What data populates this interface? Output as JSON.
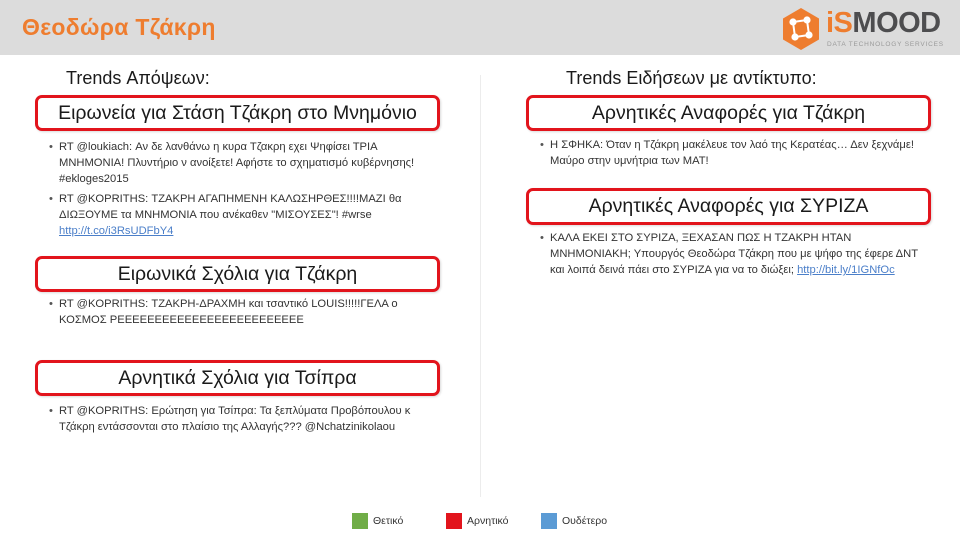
{
  "header": {
    "title": "Θεοδώρα Τζάκρη",
    "logo": {
      "text_i": "iS",
      "text_rest": "MOOD",
      "tagline": "DATA TECHNOLOGY SERVICES",
      "icon": "hexagon-network-icon",
      "accent_color": "#ee7d2f"
    }
  },
  "left": {
    "heading": "Trends Απόψεων:",
    "groups": [
      {
        "title": "Ειρωνεία για Στάση Τζάκρη στο Μνημόνιο",
        "items": [
          {
            "text": "RT @loukiach: Αν δε λανθάνω η κυρα Τζακρη εχει Ψηφίσει ΤΡΙΑ ΜΝΗΜΟΝΙΑ! Πλυντήριο ν ανοίξετε! Αφήστε το σχηματισμό κυβέρνησης! #ekloges2015",
            "link": ""
          },
          {
            "text": "RT @KOPRITHS: ΤΖΑΚΡΗ ΑΓΑΠΗΜΕΝΗ ΚΑΛΩΣΗΡΘΕΣ!!!!ΜΑΖΙ θα ΔΙΩΞΟΥΜΕ τα ΜΝΗΜΟΝΙΑ που ανέκαθεν \"ΜΙΣΟΥΣΕΣ\"! #wrse",
            "link": "http://t.co/i3RsUDFbY4"
          }
        ]
      },
      {
        "title": "Ειρωνικά Σχόλια για Τζάκρη",
        "items": [
          {
            "text": "RT @KOPRITHS: ΤΖΑΚΡΗ-ΔΡΑΧΜΗ και τσαντικό LOUIS!!!!!ΓΕΛΑ ο ΚΟΣΜΟΣ ΡΕΕΕΕΕΕΕΕΕΕΕΕΕΕΕΕΕΕΕΕΕΕΕΕΕ",
            "link": ""
          }
        ]
      },
      {
        "title": "Αρνητικά Σχόλια για Τσίπρα",
        "items": [
          {
            "text": "RT @KOPRITHS: Ερώτηση για Τσίπρα: Τα ξεπλύματα Προβόπουλου κ Τζάκρη εντάσσονται στο πλαίσιο της Αλλαγής??? @Nchatzinikolaou",
            "link": ""
          }
        ]
      }
    ]
  },
  "right": {
    "heading": "Trends Ειδήσεων με αντίκτυπο:",
    "groups": [
      {
        "title": "Αρνητικές Αναφορές για Τζάκρη",
        "items": [
          {
            "text": "Η ΣΦΗΚΑ: Όταν η Τζάκρη μακέλευε τον λαό της Κερατέας… Δεν ξεχνάμε! Μαύρο στην υμνήτρια των ΜΑΤ!",
            "link": ""
          }
        ]
      },
      {
        "title": "Αρνητικές Αναφορές για ΣΥΡΙΖΑ",
        "items": [
          {
            "text": "ΚΑΛΑ ΕΚΕΙ ΣΤΟ ΣΥΡΙΖΑ, ΞΕΧΑΣΑΝ ΠΩΣ Η ΤΖΑΚΡΗ ΗΤΑΝ ΜΝΗΜΟΝΙΑΚΗ; Υπουργός Θεοδώρα Τζάκρη που με ψήφο της έφερε ΔΝΤ και λοιπά δεινά πάει στο ΣΥΡΙΖΑ για να το διώξει;",
            "link": "http://bit.ly/1IGNfOc"
          }
        ]
      }
    ]
  },
  "legend": [
    {
      "label": "Θετικό",
      "color": "#70ad47"
    },
    {
      "label": "Αρνητικό",
      "color": "#e2141c"
    },
    {
      "label": "Ουδέτερο",
      "color": "#5b9bd5"
    }
  ]
}
